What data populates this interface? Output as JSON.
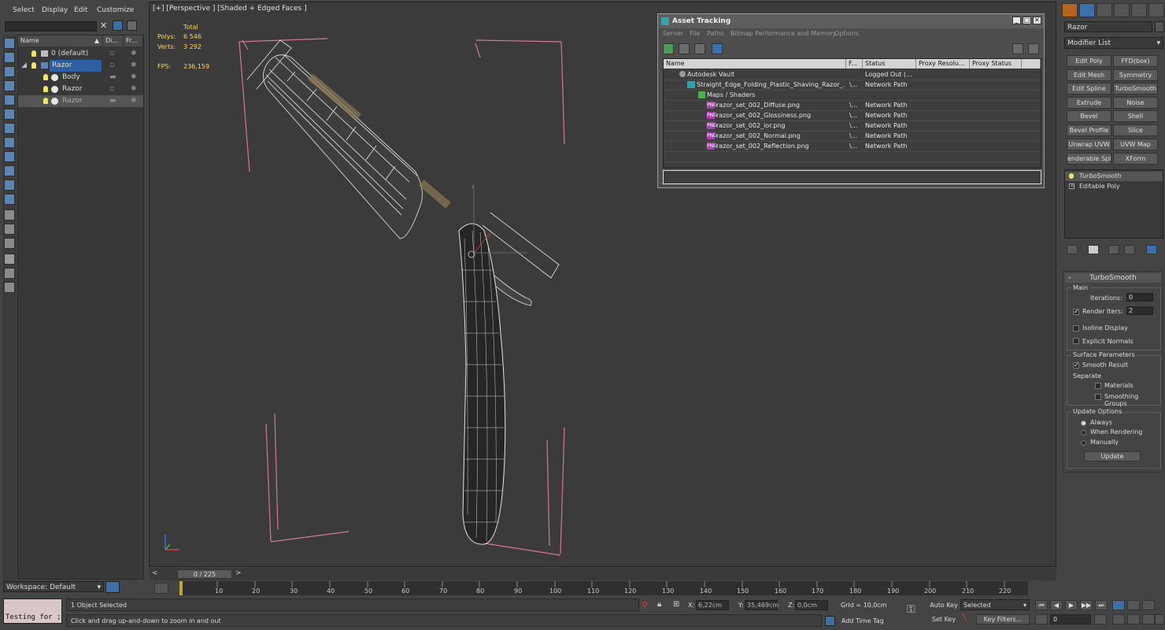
{
  "menu": {
    "select": "Select",
    "display": "Display",
    "edit": "Edit",
    "customize": "Customize"
  },
  "explorer": {
    "columns": {
      "name": "Name",
      "display": "Di...",
      "freeze": "Fr..."
    },
    "rows": [
      {
        "label": "0 (default)"
      },
      {
        "label": "Razor"
      },
      {
        "label": "Body"
      },
      {
        "label": "Razor"
      },
      {
        "label": "Razor"
      }
    ]
  },
  "workspace": "Workspace: Default",
  "viewport": {
    "label": "[+] [Perspective ] [Shaded + Edged Faces ]",
    "stats": {
      "total_label": "Total",
      "polys_label": "Polys:",
      "polys": "6 546",
      "verts_label": "Verts:",
      "verts": "3 292",
      "fps_label": "FPS:",
      "fps": "236,159"
    },
    "gizmo_z": "z",
    "gizmo_y": "y"
  },
  "asset_tracking": {
    "title": "Asset Tracking",
    "menu": [
      "Server",
      "File",
      "Paths",
      "Bitmap Performance and Memory",
      "Options"
    ],
    "columns": {
      "name": "Name",
      "f": "F...",
      "status": "Status",
      "proxy_res": "Proxy Resolu...",
      "proxy_status": "Proxy Status"
    },
    "rows": [
      {
        "name": "Autodesk Vault",
        "f": "",
        "status": "Logged Out (..."
      },
      {
        "name": "Straight_Edge_Folding_Plastic_Shaving_Razor_...",
        "f": "\\...",
        "status": "Network Path"
      },
      {
        "name": "Maps / Shaders",
        "f": "",
        "status": ""
      },
      {
        "name": "razor_set_002_Diffuse.png",
        "f": "\\...",
        "status": "Network Path"
      },
      {
        "name": "razor_set_002_Glossiness.png",
        "f": "\\...",
        "status": "Network Path"
      },
      {
        "name": "razor_set_002_ior.png",
        "f": "\\...",
        "status": "Network Path"
      },
      {
        "name": "razor_set_002_Normal.png",
        "f": "\\...",
        "status": "Network Path"
      },
      {
        "name": "razor_set_002_Reflection.png",
        "f": "\\...",
        "status": "Network Path"
      }
    ],
    "png_tag": "PNG"
  },
  "command_panel": {
    "object_name": "Razor",
    "modifier_list": "Modifier List",
    "buttons": [
      "Edit Poly",
      "FFD(box)",
      "Edit Mesh",
      "Symmetry",
      "Edit Spline",
      "TurboSmooth",
      "Extrude",
      "Noise",
      "Bevel",
      "Shell",
      "Bevel Profile",
      "Slice",
      "Unwrap UVW",
      "UVW Map",
      "enderable Splin",
      "XForm"
    ],
    "stack": [
      "TurboSmooth",
      "Editable Poly"
    ],
    "turbosmooth": {
      "title": "TurboSmooth",
      "main": "Main",
      "iterations_label": "Iterations:",
      "iterations": "0",
      "render_iters_label": "Render Iters:",
      "render_iters": "2",
      "isoline": "Isoline Display",
      "explicit": "Explicit Normals",
      "surface": "Surface Parameters",
      "smooth_result": "Smooth Result",
      "separate": "Separate",
      "materials": "Materials",
      "smoothing_groups": "Smoothing Groups",
      "update_options": "Update Options",
      "always": "Always",
      "when_rendering": "When Rendering",
      "manually": "Manually",
      "update": "Update"
    }
  },
  "timeline": {
    "slider": "0 / 225",
    "ticks": [
      "10",
      "20",
      "30",
      "40",
      "50",
      "60",
      "70",
      "80",
      "90",
      "100",
      "110",
      "120",
      "130",
      "140",
      "150",
      "160",
      "170",
      "180",
      "190",
      "200",
      "210",
      "220"
    ]
  },
  "status": {
    "maxscript": "Testing for ;",
    "selected": "1 Object Selected",
    "prompt": "Click and drag up-and-down to zoom in and out",
    "x_label": "X:",
    "x": "6,22cm",
    "y_label": "Y:",
    "y": "35,469cm",
    "z_label": "Z:",
    "z": "0,0cm",
    "grid": "Grid = 10,0cm",
    "add_time_tag": "Add Time Tag",
    "auto_key": "Auto Key",
    "selected_dd": "Selected",
    "set_key": "Set Key",
    "key_filters": "Key Filters...",
    "frame": "0"
  }
}
